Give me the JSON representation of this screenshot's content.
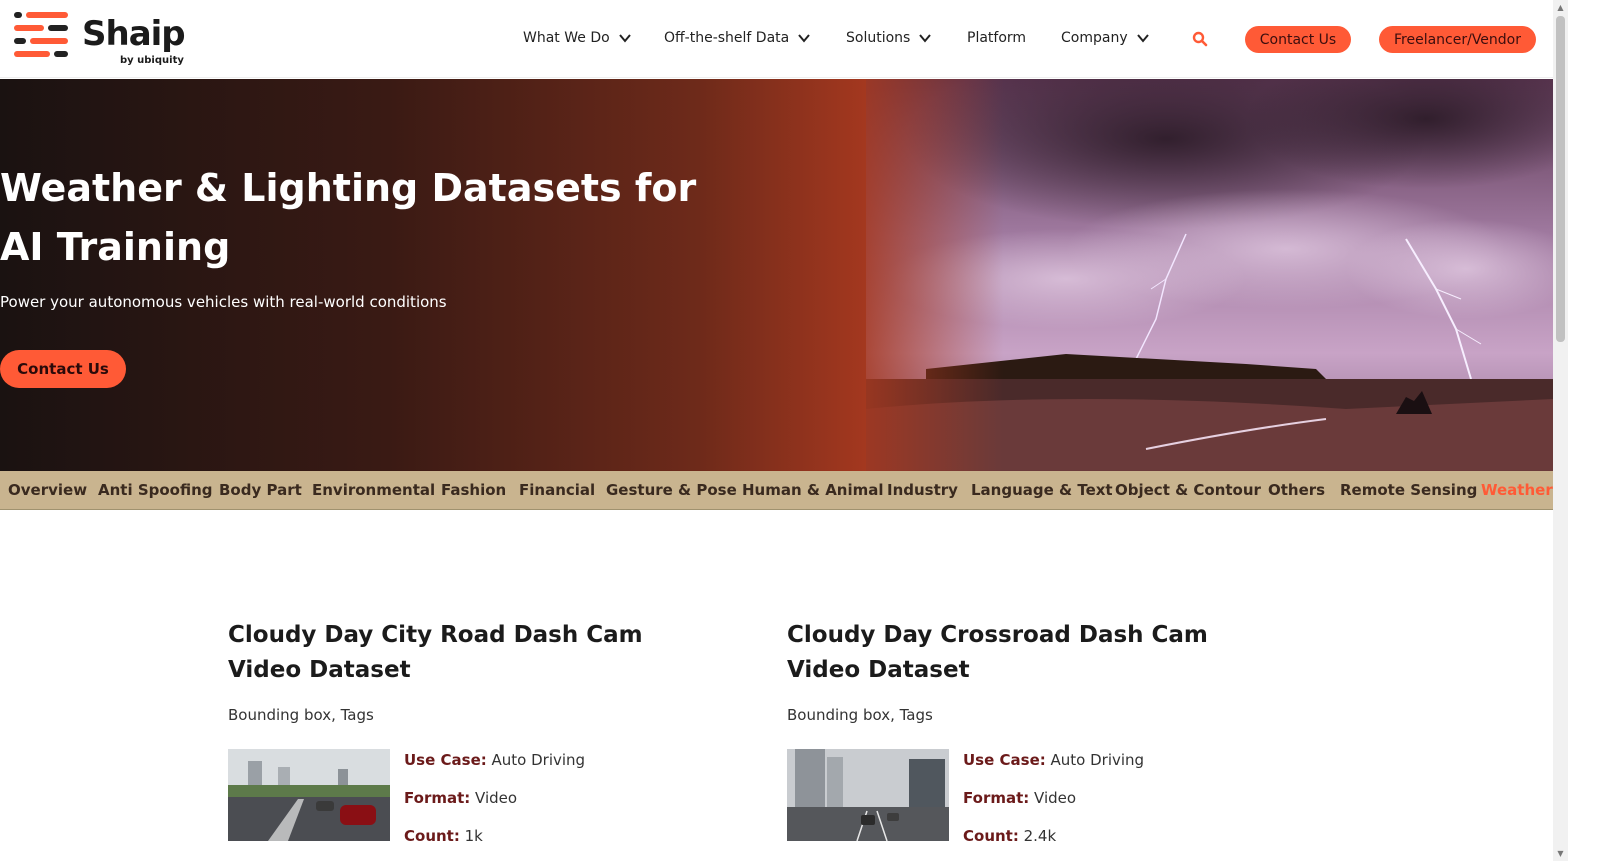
{
  "brand": {
    "name": "Shaip",
    "sub": "by ubiquity",
    "accent": "#ff5a36"
  },
  "nav": {
    "items": [
      {
        "label": "What We Do",
        "dropdown": true
      },
      {
        "label": "Off-the-shelf Data",
        "dropdown": true
      },
      {
        "label": "Solutions",
        "dropdown": true
      },
      {
        "label": "Platform",
        "dropdown": false
      },
      {
        "label": "Company",
        "dropdown": true
      }
    ],
    "search_icon": "search-icon",
    "contact_label": "Contact Us",
    "freelancer_label": "Freelancer/Vendor"
  },
  "hero": {
    "title": "Weather & Lighting Datasets for AI Training",
    "subtitle": "Power your autonomous vehicles with real-world conditions",
    "cta_label": "Contact Us"
  },
  "categories": [
    {
      "label": "Overview",
      "active": false
    },
    {
      "label": "Anti Spoofing",
      "active": false
    },
    {
      "label": "Body Part",
      "active": false
    },
    {
      "label": "Environmental",
      "active": false
    },
    {
      "label": "Fashion",
      "active": false
    },
    {
      "label": "Financial",
      "active": false
    },
    {
      "label": "Gesture & Pose",
      "active": false
    },
    {
      "label": "Human & Animal",
      "active": false
    },
    {
      "label": "Industry",
      "active": false
    },
    {
      "label": "Language & Text",
      "active": false
    },
    {
      "label": "Object & Contour",
      "active": false
    },
    {
      "label": "Others",
      "active": false
    },
    {
      "label": "Remote Sensing",
      "active": false
    },
    {
      "label": "Weather",
      "active": true
    }
  ],
  "datasets": [
    {
      "title": "Cloudy Day City Road Dash Cam Video Dataset",
      "tags": "Bounding box, Tags",
      "use_case_label": "Use Case:",
      "use_case": "Auto Driving",
      "format_label": "Format:",
      "format": "Video",
      "count_label": "Count:",
      "count": "1k"
    },
    {
      "title": "Cloudy Day Crossroad Dash Cam Video Dataset",
      "tags": "Bounding box, Tags",
      "use_case_label": "Use Case:",
      "use_case": "Auto Driving",
      "format_label": "Format:",
      "format": "Video",
      "count_label": "Count:",
      "count": "2.4k"
    }
  ]
}
